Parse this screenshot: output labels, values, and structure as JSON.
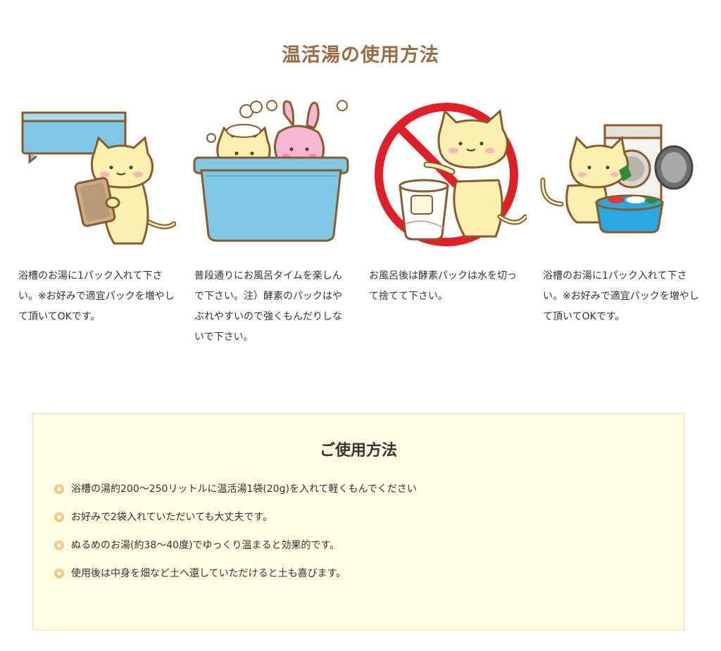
{
  "title": "温活湯の使用方法",
  "steps": [
    {
      "caption": "浴槽のお湯に1パック入れて下さい。※お好みで適宜パックを増やして頂いてOKです。",
      "icon": "cat-holding-pack-icon"
    },
    {
      "caption": "普段通りにお風呂タイムを楽しんで下さい。注）酵素のパックはやぶれやすいので強くもんだりしないで下さい。",
      "icon": "cat-bathing-icon"
    },
    {
      "caption": "お風呂後は酵素パックは水を切って捨てて下さい。",
      "icon": "cat-discarding-pack-icon"
    },
    {
      "caption": "浴槽のお湯に1パック入れて下さい。※お好みで適宜パックを増やして頂いてOKです。",
      "icon": "cat-laundry-icon"
    }
  ],
  "usage": {
    "title": "ご使用方法",
    "items": [
      "浴槽の湯約200〜250リットルに温活湯1袋(20g)を入れて軽くもんでください",
      "お好みで2袋入れていただいても大丈夫です。",
      "ぬるめのお湯(約38〜40度)でゆっくり温まると効果的です。",
      "使用後は中身を畑など土へ還していただけると土も喜びます。"
    ]
  },
  "colors": {
    "title": "#9b6a42",
    "cat_body": "#fdf0b0",
    "outline": "#8a5a2b",
    "tub_blue": "#7ec8e6",
    "prohibited_red": "#e21e26",
    "usage_bg": "#fffde3",
    "bullet": "#f7c888"
  }
}
